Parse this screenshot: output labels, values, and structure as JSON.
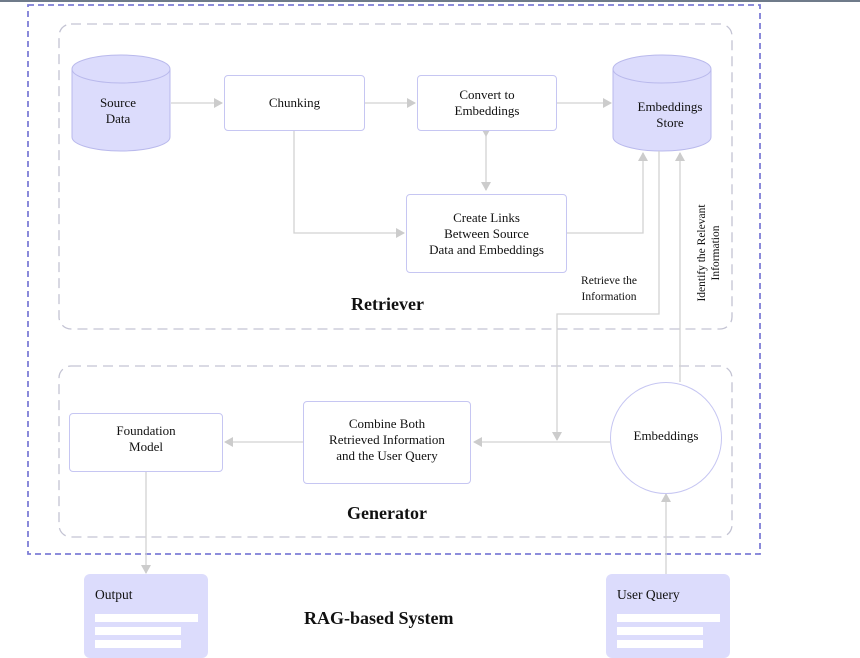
{
  "diagram": {
    "title": "RAG-based System",
    "colors": {
      "outer_border": "#7d7dd6",
      "group_border": "#c3c3d3",
      "node_border": "#c6c6f2",
      "cylinder_fill": "#dcdcfc",
      "card_fill": "#dcdcfc",
      "edge": "#cccccc"
    },
    "groups": {
      "retriever": {
        "label": "Retriever"
      },
      "generator": {
        "label": "Generator"
      }
    },
    "nodes": {
      "source_data": "Source\nData",
      "chunking": "Chunking",
      "convert_embeddings": "Convert to\nEmbeddings",
      "embeddings_store": "Embeddings\nStore",
      "create_links": "Create Links\nBetween Source\nData and Embeddings",
      "foundation_model": "Foundation\nModel",
      "combine": "Combine Both\nRetrieved Information\nand the User Query",
      "embeddings": "Embeddings",
      "output": "Output",
      "user_query": "User Query"
    },
    "edge_labels": {
      "retrieve": "Retrieve the\nInformation",
      "identify": "Identify the Relevant\nInformation"
    },
    "edges": [
      {
        "from": "source_data",
        "to": "chunking"
      },
      {
        "from": "chunking",
        "to": "convert_embeddings"
      },
      {
        "from": "convert_embeddings",
        "to": "embeddings_store"
      },
      {
        "from": "chunking",
        "to": "create_links"
      },
      {
        "from": "convert_embeddings",
        "to": "create_links",
        "bidirectional": true
      },
      {
        "from": "create_links",
        "to": "embeddings_store"
      },
      {
        "from": "embeddings_store",
        "to": "combine",
        "label": "Retrieve the Information"
      },
      {
        "from": "embeddings",
        "to": "embeddings_store",
        "label": "Identify the Relevant Information"
      },
      {
        "from": "embeddings",
        "to": "combine"
      },
      {
        "from": "combine",
        "to": "foundation_model"
      },
      {
        "from": "foundation_model",
        "to": "output"
      },
      {
        "from": "user_query",
        "to": "embeddings"
      }
    ]
  }
}
